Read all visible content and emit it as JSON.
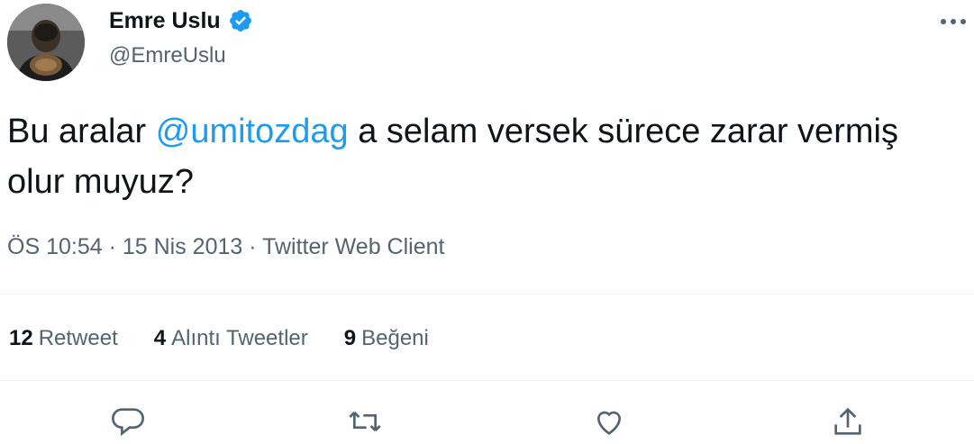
{
  "author": {
    "name": "Emre Uslu",
    "handle": "@EmreUslu",
    "verified": true,
    "avatar_icon": "user-avatar"
  },
  "tweet": {
    "text_before": "Bu aralar ",
    "mention": "@umitozdag",
    "text_after": " a selam versek sürece zarar vermiş olur muyuz?"
  },
  "meta": {
    "time": "ÖS 10:54",
    "separator": "·",
    "date": "15 Nis 2013",
    "client": "Twitter Web Client"
  },
  "stats": [
    {
      "count": "12",
      "label": "Retweet"
    },
    {
      "count": "4",
      "label": "Alıntı Tweetler"
    },
    {
      "count": "9",
      "label": "Beğeni"
    }
  ],
  "actions": [
    {
      "icon": "reply-icon"
    },
    {
      "icon": "retweet-icon"
    },
    {
      "icon": "like-icon"
    },
    {
      "icon": "share-icon"
    }
  ],
  "colors": {
    "accent": "#1d9bf0",
    "text": "#0f1419",
    "secondary": "#536471",
    "divider": "#eff3f4"
  }
}
